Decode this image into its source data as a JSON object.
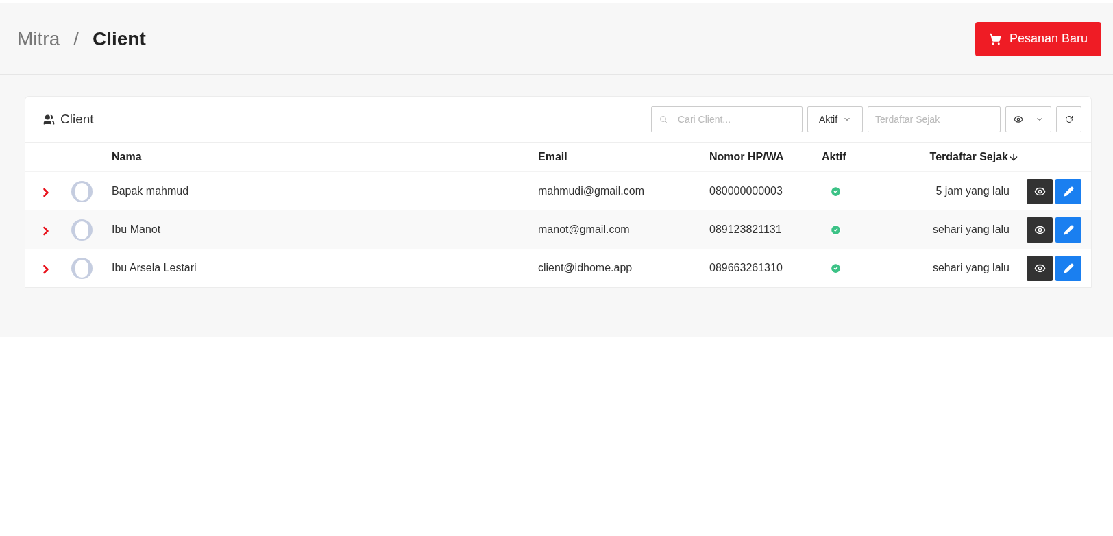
{
  "breadcrumb": {
    "parent": "Mitra",
    "separator": "/",
    "current": "Client"
  },
  "new_order_button": {
    "label": "Pesanan Baru"
  },
  "card": {
    "title": "Client",
    "search": {
      "placeholder": "Cari Client..."
    },
    "status_filter": {
      "value": "Aktif"
    },
    "date_filter": {
      "placeholder": "Terdaftar Sejak"
    }
  },
  "table": {
    "columns": [
      {
        "label": "Nama"
      },
      {
        "label": "Email"
      },
      {
        "label": "Nomor HP/WA"
      },
      {
        "label": "Aktif"
      },
      {
        "label": "Terdaftar Sejak",
        "sorted": true
      }
    ],
    "rows": [
      {
        "name": "Bapak mahmud",
        "email": "mahmudi@gmail.com",
        "phone": "080000000003",
        "active": true,
        "registered": "5 jam yang lalu"
      },
      {
        "name": "Ibu Manot",
        "email": "manot@gmail.com",
        "phone": "089123821131",
        "active": true,
        "registered": "sehari yang lalu"
      },
      {
        "name": "Ibu Arsela Lestari",
        "email": "client@idhome.app",
        "phone": "089663261310",
        "active": true,
        "registered": "sehari yang lalu"
      }
    ]
  }
}
